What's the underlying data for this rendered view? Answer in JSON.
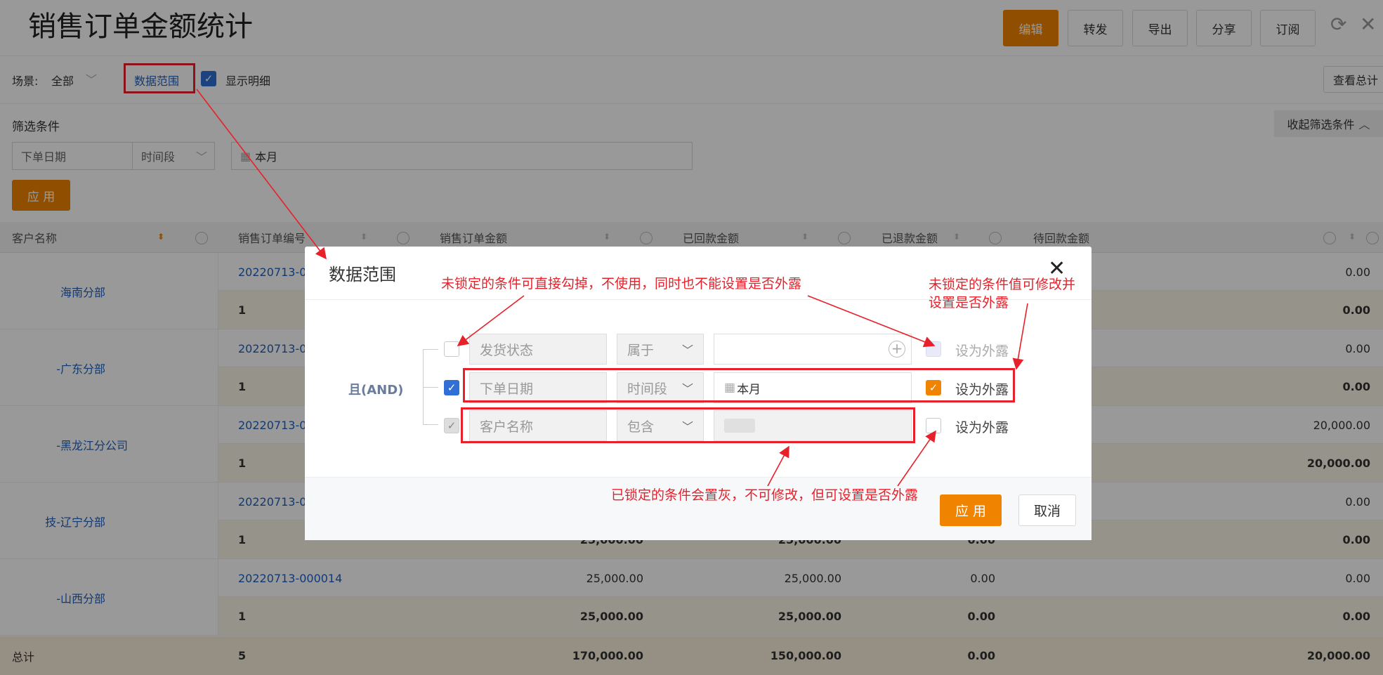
{
  "header": {
    "title": "销售订单金额统计",
    "buttons": [
      "编辑",
      "转发",
      "导出",
      "分享",
      "订阅"
    ],
    "refresh_icon": "refresh-icon",
    "close_icon": "close-icon"
  },
  "toolbar": {
    "scene_label": "场景:",
    "scene_value": "全部",
    "data_range_link": "数据范围",
    "show_detail_label": "显示明细",
    "show_detail_checked": true,
    "view_total_button": "查看总计"
  },
  "filter": {
    "title": "筛选条件",
    "collapse_label": "收起筛选条件",
    "field_name": "下单日期",
    "operator": "时间段",
    "value": "本月",
    "apply_button": "应 用"
  },
  "table": {
    "columns": [
      "客户名称",
      "销售订单编号",
      "销售订单金额",
      "已回款金额",
      "已退款金额",
      "待回款金额"
    ],
    "groups": [
      {
        "customer": "海南分部",
        "order_no": "20220713-00",
        "amount": "",
        "received": "",
        "refunded": "",
        "pending": "0.00",
        "count": "1",
        "sum_amount": "",
        "sum_received": "",
        "sum_refunded": "",
        "sum_pending": "0.00"
      },
      {
        "customer": "-广东分部",
        "order_no": "20220713-00",
        "amount": "",
        "received": "",
        "refunded": "",
        "pending": "0.00",
        "count": "1",
        "sum_amount": "",
        "sum_received": "",
        "sum_refunded": "",
        "sum_pending": "0.00"
      },
      {
        "customer": "-黑龙江分公司",
        "order_no": "20220713-00",
        "amount": "",
        "received": "",
        "refunded": "",
        "pending": "20,000.00",
        "count": "1",
        "sum_amount": "",
        "sum_received": "",
        "sum_refunded": "",
        "sum_pending": "20,000.00"
      },
      {
        "customer": "技-辽宁分部",
        "order_no": "20220713-00",
        "amount": "",
        "received": "",
        "refunded": "",
        "pending": "0.00",
        "count": "1",
        "sum_amount": "25,000.00",
        "sum_received": "25,000.00",
        "sum_refunded": "0.00",
        "sum_pending": "0.00"
      },
      {
        "customer": "-山西分部",
        "order_no": "20220713-000014",
        "amount": "25,000.00",
        "received": "25,000.00",
        "refunded": "0.00",
        "pending": "0.00",
        "count": "1",
        "sum_amount": "25,000.00",
        "sum_received": "25,000.00",
        "sum_refunded": "0.00",
        "sum_pending": "0.00"
      }
    ],
    "total": {
      "label": "总计",
      "count": "5",
      "amount": "170,000.00",
      "received": "150,000.00",
      "refunded": "0.00",
      "pending": "20,000.00"
    }
  },
  "dialog": {
    "title": "数据范围",
    "logic": "且(AND)",
    "rows": [
      {
        "field": "发货状态",
        "operator": "属于",
        "value": "",
        "checked": false,
        "expose": false,
        "expose_label": "设为外露"
      },
      {
        "field": "下单日期",
        "operator": "时间段",
        "value": "本月",
        "checked": true,
        "expose": true,
        "expose_label": "设为外露"
      },
      {
        "field": "客户名称",
        "operator": "包含",
        "value": "",
        "checked": true,
        "locked": true,
        "expose": false,
        "expose_label": "设为外露"
      }
    ],
    "apply_button": "应 用",
    "cancel_button": "取消"
  },
  "annotations": {
    "top_left": "未锁定的条件可直接勾掉，不使用，同时也不能设置是否外露",
    "top_right_line1": "未锁定的条件值可修改并",
    "top_right_line2": "设置是否外露",
    "bottom": "已锁定的条件会置灰，不可修改，但可设置是否外露"
  },
  "colors": {
    "primary": "#f08300",
    "link": "#1f5fbf",
    "annotation": "#e8202a",
    "checkbox_blue": "#2f6fd6"
  }
}
